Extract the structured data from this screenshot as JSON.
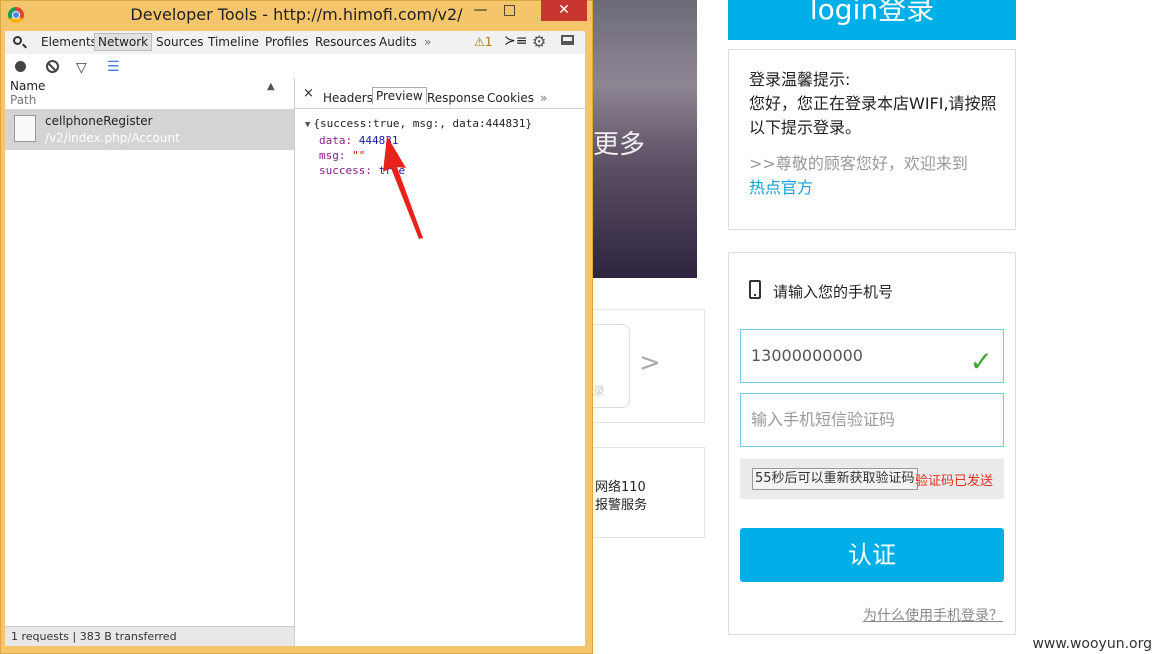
{
  "background_page": {
    "hero_text": "更多",
    "card_a": {
      "arrow": ">",
      "faint_text": "录"
    },
    "card_b": {
      "line1": "网络110",
      "line2": "报警服务"
    },
    "login_banner": "login登录",
    "notice": {
      "title": "登录温馨提示:",
      "body": "您好，您正在登录本店WIFI,请按照以下提示登录。",
      "welcome": ">>尊敬的顾客您好，欢迎来到",
      "link": "热点官方"
    },
    "form": {
      "phone_label": "请输入您的手机号",
      "phone_value": "13000000000",
      "check_icon": "✓",
      "code_placeholder": "输入手机短信验证码",
      "resend_button": "55秒后可以重新获取验证码",
      "sent_status": "验证码已发送",
      "submit_button": "认证",
      "why_link": "为什么使用手机登录？"
    },
    "watermark": "www.wooyun.org"
  },
  "devtools": {
    "window_title": "Developer Tools - http://m.himofi.com/v2/",
    "window_controls": {
      "minimize": "—",
      "maximize": "□",
      "close": "✕"
    },
    "tabs": [
      "Elements",
      "Network",
      "Sources",
      "Timeline",
      "Profiles",
      "Resources",
      "Audits"
    ],
    "active_tab": "Network",
    "more_tabs": "»",
    "warning_badge": "⚠1",
    "toolbar_icons": [
      "search-icon",
      "console-icon",
      "gear-icon",
      "dock-icon"
    ],
    "network": {
      "column_name": "Name",
      "column_path": "Path",
      "sort_arrow": "▲",
      "requests": [
        {
          "name": "cellphoneRegister",
          "path": "/v2/index.php/Account"
        }
      ],
      "status_text": "1 requests | 383 B transferred"
    },
    "detail": {
      "close": "×",
      "tabs": [
        "Headers",
        "Preview",
        "Response",
        "Cookies"
      ],
      "selected_tab": "Preview",
      "more": "»",
      "summary": "{success:true, msg:, data:444831}",
      "fields": [
        {
          "key": "data",
          "value": "444831",
          "type": "number"
        },
        {
          "key": "msg",
          "value": "\"\"",
          "type": "string"
        },
        {
          "key": "success",
          "value": "true",
          "type": "bool"
        }
      ]
    }
  },
  "colors": {
    "window_frame": "#f5c56b",
    "accent_blue": "#00aee8",
    "close_red": "#c7372f",
    "annotation_arrow": "#e8231b",
    "check_green": "#3aaa35"
  }
}
